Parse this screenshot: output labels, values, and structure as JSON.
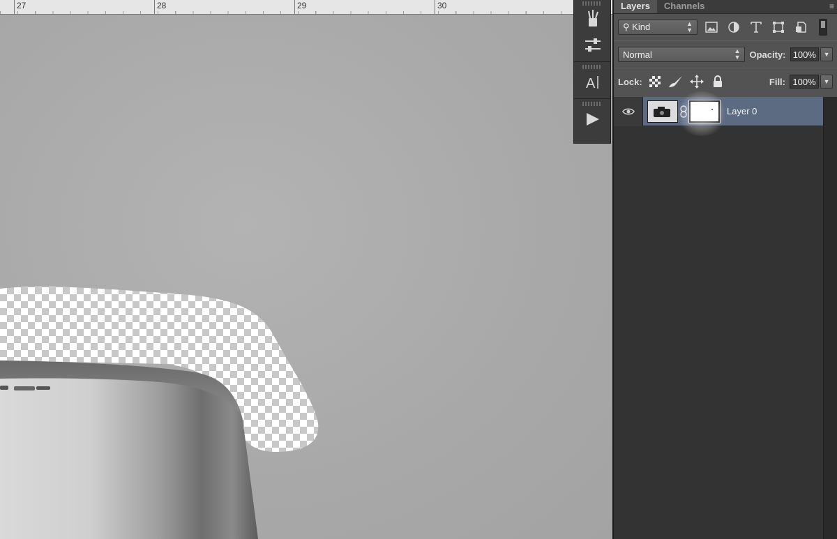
{
  "ruler": {
    "labels": [
      "27",
      "28",
      "29",
      "30"
    ]
  },
  "tool_strip": {
    "tools": [
      {
        "name": "brush-preset-icon"
      },
      {
        "name": "adjustment-sliders-icon"
      },
      {
        "name": "character-type-icon"
      },
      {
        "name": "play-action-icon"
      }
    ]
  },
  "panel": {
    "tabs": [
      {
        "label": "Layers",
        "active": true
      },
      {
        "label": "Channels",
        "active": false
      }
    ],
    "filter": {
      "kind_label": "Kind",
      "icons": [
        "image-filter-icon",
        "adjustment-filter-icon",
        "type-filter-icon",
        "shape-filter-icon",
        "smart-object-filter-icon"
      ]
    },
    "blend": {
      "mode": "Normal",
      "opacity_label": "Opacity:",
      "opacity_value": "100%"
    },
    "lock": {
      "label": "Lock:",
      "icons": [
        "lock-transparent-icon",
        "lock-image-icon",
        "lock-position-icon",
        "lock-all-icon"
      ],
      "fill_label": "Fill:",
      "fill_value": "100%"
    },
    "layers": [
      {
        "name": "Layer 0",
        "visible": true,
        "has_mask": true,
        "selected": true
      }
    ]
  },
  "colors": {
    "panel_bg": "#535353",
    "selected_layer": "#5c6a82",
    "canvas_gray": "#a9a9a9"
  }
}
